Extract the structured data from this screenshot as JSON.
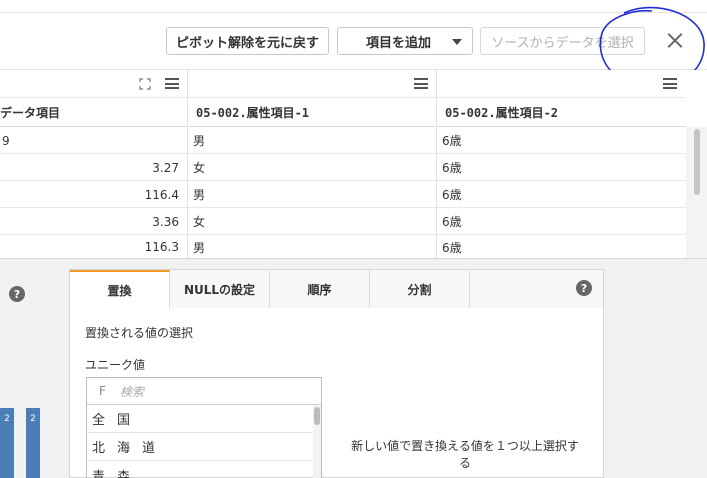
{
  "toolbar": {
    "pivot_undo_label": "ピボット解除を元に戻す",
    "add_item_label": "項目を追加",
    "select_source_label": "ソースからデータを選択"
  },
  "table": {
    "headers": [
      "データ項目",
      "05-002.属性項目-1",
      "05-002.属性項目-2"
    ],
    "rows": [
      {
        "c1": "9",
        "c2": "男",
        "c3": "6歳"
      },
      {
        "c1": "3.27",
        "c2": "女",
        "c3": "6歳"
      },
      {
        "c1": "116.4",
        "c2": "男",
        "c3": "6歳"
      },
      {
        "c1": "3.36",
        "c2": "女",
        "c3": "6歳"
      },
      {
        "c1": "116.3",
        "c2": "男",
        "c3": "6歳"
      }
    ]
  },
  "left_panel": {
    "help": "?",
    "bar_labels": [
      "2",
      "2"
    ]
  },
  "dialog": {
    "tabs": [
      "置換",
      "NULLの設定",
      "順序",
      "分割"
    ],
    "active_tab": "置換",
    "help": "?",
    "select_label": "置換される値の選択",
    "unique_label": "ユニーク値",
    "search_icon": "F",
    "search_placeholder": "検索",
    "unique_values": [
      "全国",
      "北海道",
      "青森"
    ],
    "hint": "新しい値で置き換える値を１つ以上選択する"
  },
  "colors": {
    "accent_tab": "#f29a25",
    "bar": "#4b7db6",
    "annotation_circle": "#1f2fd1"
  }
}
